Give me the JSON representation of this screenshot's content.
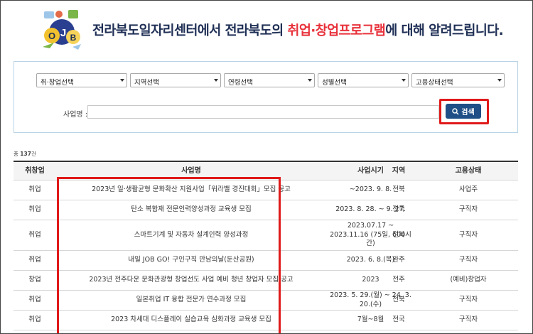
{
  "banner": {
    "headline_prefix": "전라북도일자리센터에서 전라북도의 ",
    "headline_highlight": "취업·창업프로그램",
    "headline_suffix": "에 대해 알려드립니다."
  },
  "filters": {
    "selects": [
      {
        "label": "취·창업선택"
      },
      {
        "label": "지역선택"
      },
      {
        "label": "연령선택"
      },
      {
        "label": "성별선택"
      },
      {
        "label": "고용상태선택"
      }
    ],
    "name_label": "사업명 :",
    "name_value": "",
    "search_label": "검색"
  },
  "total": {
    "prefix": "총 ",
    "count": "137",
    "suffix": "건"
  },
  "table": {
    "headers": [
      "취창업",
      "사업명",
      "사업시기",
      "지역",
      "고용상태"
    ],
    "rows": [
      {
        "type": "취업",
        "name": "2023년 일·생활균형 문화확산 지원사업「워라밸 경진대회」모집 공고",
        "period": "~2023. 9. 8.",
        "region": "전북",
        "status": "사업주"
      },
      {
        "type": "취업",
        "name": "탄소 복합재 전문인력양성과정 교육생 모집",
        "period": "2023. 8. 28. ~ 9. 27.",
        "region": "전국",
        "status": "구직자"
      },
      {
        "type": "취업",
        "name": "스마트기계 및 자동차 설계인력 양성과정",
        "period": "2023.07.17 ~ 2023.11.16 (75일, 600시간)",
        "region": "전북",
        "status": "구직자"
      },
      {
        "type": "취업",
        "name": "내일 JOB GO! 구인구직 만남의날(둔산공원)",
        "period": "2023. 6. 8.(목)",
        "region": "완주",
        "status": "구직자"
      },
      {
        "type": "창업",
        "name": "2023년 전주다운 문화관광형 창업선도 사업 예비 청년 창업자 모집 공고",
        "period": "2023",
        "region": "전주",
        "status": "(예비)창업자"
      },
      {
        "type": "취업",
        "name": "일본취업 IT 융합 전문가 연수과정 모집",
        "period": "2023. 5. 29.(월) ~ 24. 3. 20.(수)",
        "region": "전북",
        "status": "구직자"
      },
      {
        "type": "취업",
        "name": "2023 차세대 디스플레이 실습교육 심화과정 교육생 모집",
        "period": "7월~8월",
        "region": "전국",
        "status": "구직자"
      }
    ]
  },
  "colors": {
    "accent": "#e8323c",
    "headline": "#1f2f55",
    "button": "#1f4f86",
    "highlight_box": "#e01a1a"
  }
}
